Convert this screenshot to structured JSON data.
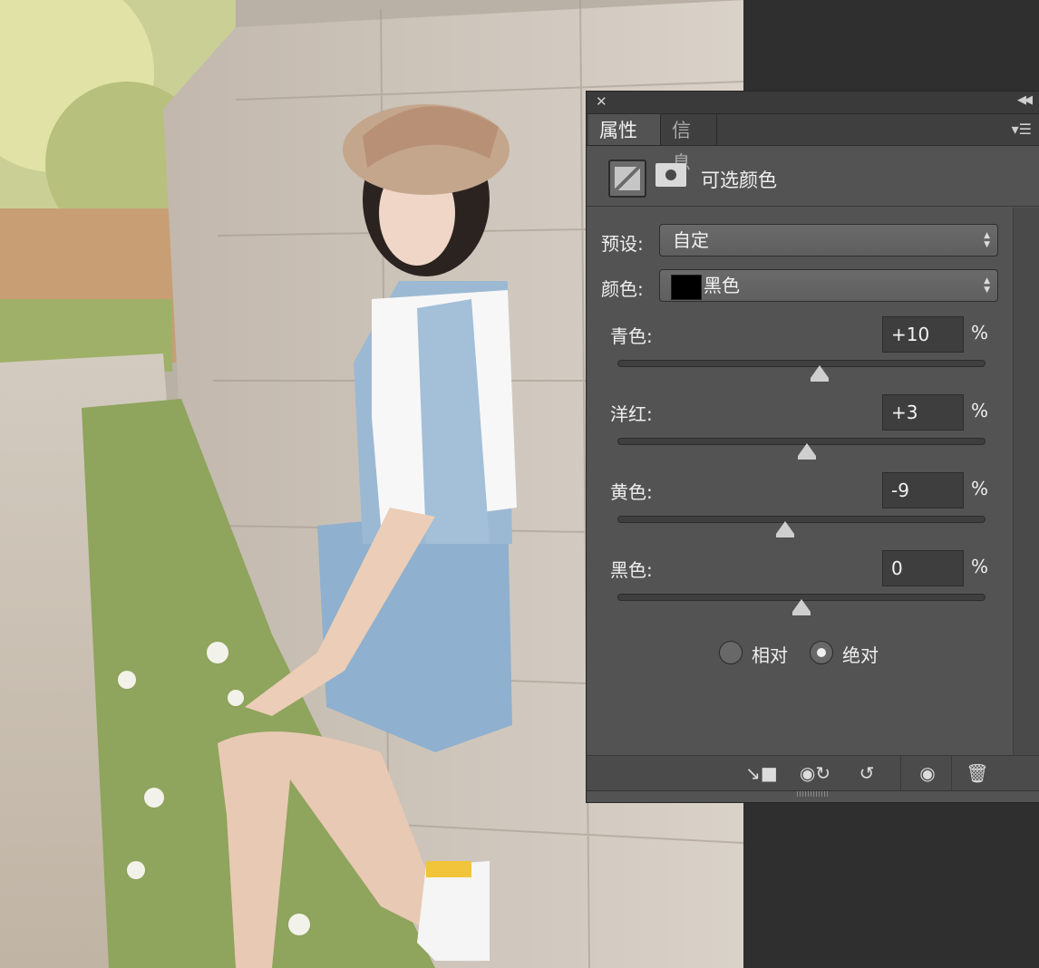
{
  "panel": {
    "tabs": [
      {
        "label": "属性",
        "active": true
      },
      {
        "label": "信息",
        "active": false
      }
    ],
    "icons": {
      "close": "close-icon",
      "collapse": "double-chevron-icon",
      "menu": "panel-menu-icon",
      "adjustment": "selective-color-adjustment-icon",
      "mask": "layer-mask-icon"
    },
    "adjustment_title": "可选颜色",
    "preset": {
      "label": "预设:",
      "value": "自定"
    },
    "colors": {
      "label": "颜色:",
      "value": "黑色",
      "swatch": "#000000"
    },
    "sliders": [
      {
        "label": "青色:",
        "value": "+10",
        "unit": "%",
        "level": 10
      },
      {
        "label": "洋红:",
        "value": "+3",
        "unit": "%",
        "level": 3
      },
      {
        "label": "黄色:",
        "value": "-9",
        "unit": "%",
        "level": -9
      },
      {
        "label": "黑色:",
        "value": "0",
        "unit": "%",
        "level": 0
      }
    ],
    "method": {
      "options": [
        {
          "label": "相对",
          "selected": false
        },
        {
          "label": "绝对",
          "selected": true
        }
      ]
    },
    "bottom_icons": [
      "clip-to-layer-icon",
      "view-previous-state-icon",
      "reset-icon",
      "visibility-eye-icon",
      "trash-icon"
    ]
  }
}
